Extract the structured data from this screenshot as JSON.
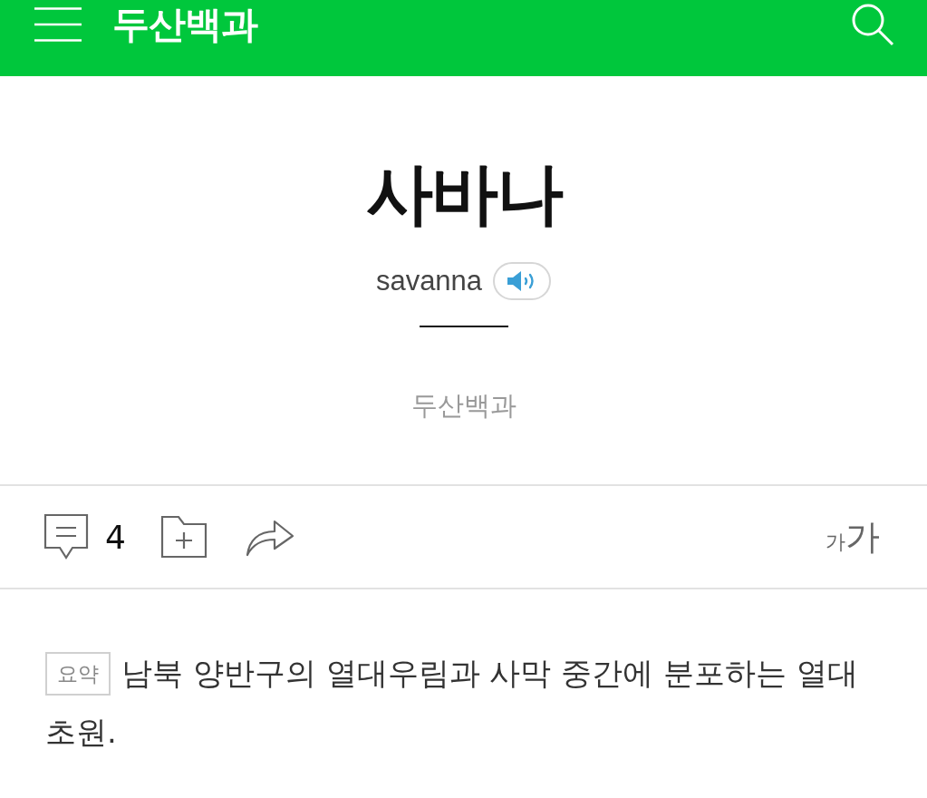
{
  "header": {
    "title": "두산백과"
  },
  "entry": {
    "title": "사바나",
    "romanization": "savanna",
    "source": "두산백과"
  },
  "toolbar": {
    "comment_count": "4",
    "font_size": {
      "small": "가",
      "large": "가"
    }
  },
  "summary": {
    "badge": "요약",
    "text": "남북 양반구의 열대우림과 사막 중간에 분포하는 열대 초원."
  }
}
